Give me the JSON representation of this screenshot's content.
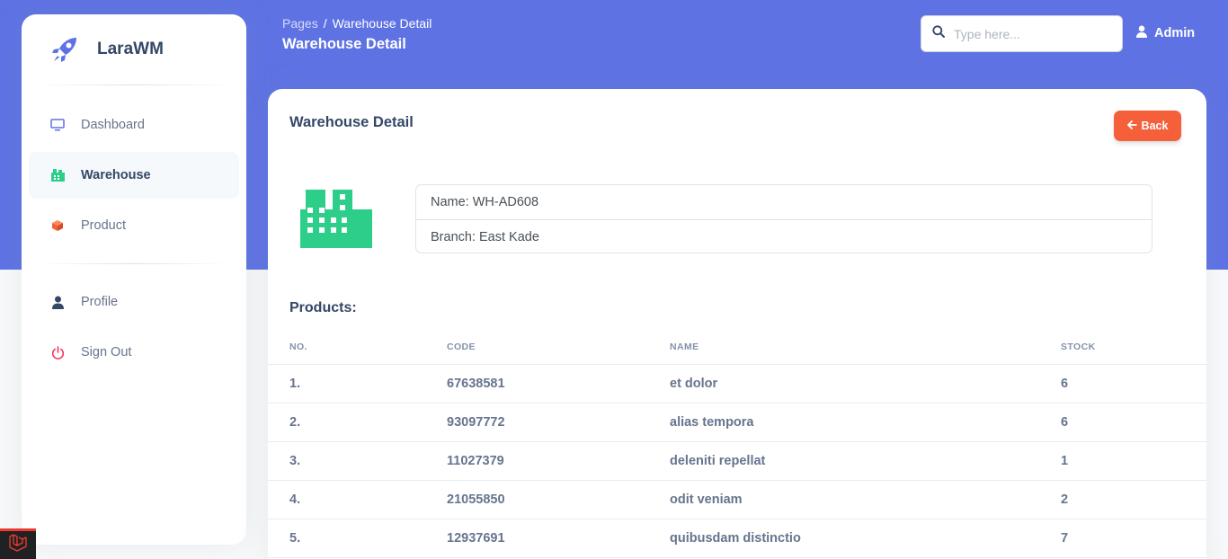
{
  "app": {
    "name": "LaraWM"
  },
  "sidebar": {
    "items": [
      {
        "label": "Dashboard",
        "icon": "monitor-icon"
      },
      {
        "label": "Warehouse",
        "icon": "warehouse-icon"
      },
      {
        "label": "Product",
        "icon": "box-icon"
      }
    ],
    "account_items": [
      {
        "label": "Profile",
        "icon": "user-icon"
      },
      {
        "label": "Sign Out",
        "icon": "power-icon"
      }
    ]
  },
  "header": {
    "breadcrumb_root": "Pages",
    "breadcrumb_separator": "/",
    "breadcrumb_current": "Warehouse Detail",
    "page_title": "Warehouse Detail"
  },
  "search": {
    "placeholder": "Type here..."
  },
  "user": {
    "label": "Admin"
  },
  "card": {
    "title": "Warehouse Detail",
    "back_label": "Back",
    "name_line": "Name: WH-AD608",
    "branch_line": "Branch: East Kade",
    "products_label": "Products:"
  },
  "table": {
    "headers": [
      "No.",
      "Code",
      "Name",
      "Stock"
    ],
    "rows": [
      [
        "1.",
        "67638581",
        "et dolor",
        "6"
      ],
      [
        "2.",
        "93097772",
        "alias tempora",
        "6"
      ],
      [
        "3.",
        "11027379",
        "deleniti repellat",
        "1"
      ],
      [
        "4.",
        "21055850",
        "odit veniam",
        "2"
      ],
      [
        "5.",
        "12937691",
        "quibusdam distinctio",
        "7"
      ]
    ]
  },
  "colors": {
    "primary": "#5e72e4",
    "accent": "#f5603b",
    "success": "#2dce89",
    "danger": "#f5365c"
  }
}
